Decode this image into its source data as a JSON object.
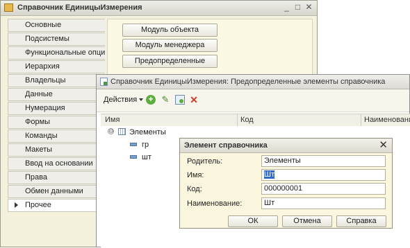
{
  "main_window": {
    "title": "Справочник ЕдиницыИзмерения",
    "window_controls": [
      "_",
      "□",
      "✕"
    ],
    "sidebar": {
      "items": [
        {
          "label": "Основные"
        },
        {
          "label": "Подсистемы"
        },
        {
          "label": "Функциональные опции"
        },
        {
          "label": "Иерархия"
        },
        {
          "label": "Владельцы"
        },
        {
          "label": "Данные"
        },
        {
          "label": "Нумерация"
        },
        {
          "label": "Формы"
        },
        {
          "label": "Команды"
        },
        {
          "label": "Макеты"
        },
        {
          "label": "Ввод на основании"
        },
        {
          "label": "Права"
        },
        {
          "label": "Обмен данными"
        },
        {
          "label": "Прочее",
          "active": true
        }
      ]
    },
    "buttons": {
      "object_module": "Модуль объекта",
      "manager_module": "Модуль менеджера",
      "predefined": "Предопределенные"
    }
  },
  "predefined_window": {
    "title": "Справочник ЕдиницыИзмерения: Предопределенные элементы справочника",
    "toolbar": {
      "actions_label": "Действия",
      "icons": [
        "add-icon",
        "edit-icon",
        "copy-icon",
        "delete-icon"
      ]
    },
    "columns": [
      "Имя",
      "Код",
      "Наименование"
    ],
    "tree": {
      "root_expander": "⊖",
      "root_label": "Элементы",
      "children": [
        "гр",
        "шт"
      ]
    }
  },
  "dialog": {
    "title": "Элемент справочника",
    "close_glyph": "✕",
    "fields": {
      "parent_label": "Родитель:",
      "parent_value": "Элементы",
      "name_label": "Имя:",
      "name_value": "Шт",
      "code_label": "Код:",
      "code_value": "000000001",
      "title_label": "Наименование:",
      "title_value": "Шт"
    },
    "buttons": {
      "ok": "ОК",
      "cancel": "Отмена",
      "help": "Справка"
    }
  },
  "colors": {
    "window_bg": "#f4f1dc",
    "selection": "#316ac5",
    "add_green": "#5caf3e",
    "delete_red": "#d43a2a"
  }
}
